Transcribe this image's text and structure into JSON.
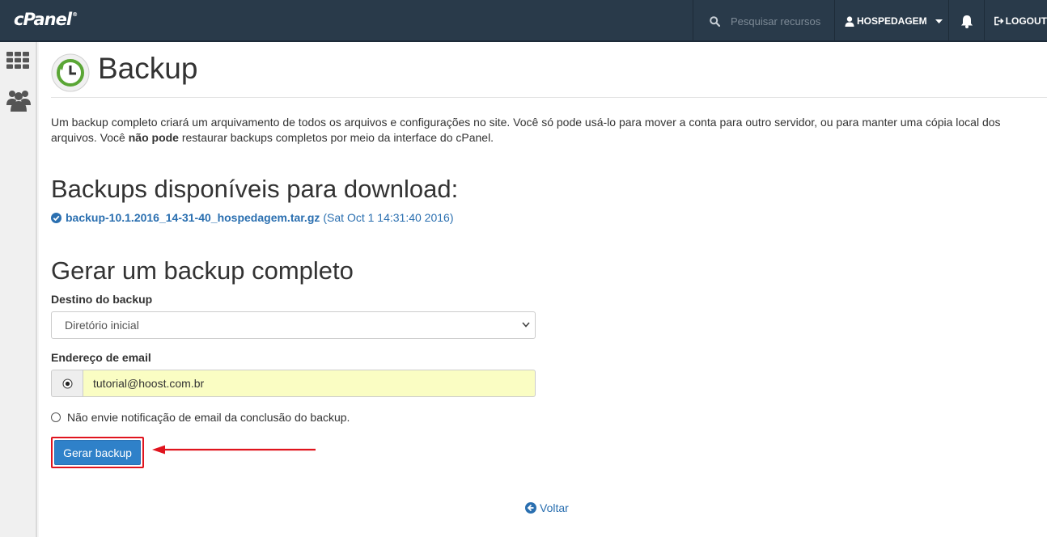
{
  "topbar": {
    "logo_text": "cPanel",
    "logo_mark": "®",
    "search_placeholder": "Pesquisar recursos",
    "user_label": "HOSPEDAGEM",
    "logout_label": "LOGOUT"
  },
  "sidebar": {
    "items": [
      {
        "icon": "grid-icon"
      },
      {
        "icon": "users-icon"
      }
    ]
  },
  "header": {
    "title": "Backup",
    "icon": "backup-clock-icon"
  },
  "intro": {
    "part1": "Um backup completo criará um arquivamento de todos os arquivos e configurações no site. Você só pode usá-lo para mover a conta para outro servidor, ou para manter uma cópia local dos arquivos. Você ",
    "bold": "não pode",
    "part2": " restaurar backups completos por meio da interface do cPanel."
  },
  "available": {
    "heading": "Backups disponíveis para download:",
    "file_name": "backup-10.1.2016_14-31-40_hospedagem.tar.gz",
    "file_date": "(Sat Oct 1 14:31:40 2016)"
  },
  "generate": {
    "heading": "Gerar um backup completo",
    "destination_label": "Destino do backup",
    "destination_value": "Diretório inicial",
    "email_label": "Endereço de email",
    "email_value": "tutorial@hoost.com.br",
    "no_notify_label": "Não envie notificação de email da conclusão do backup.",
    "button_label": "Gerar backup"
  },
  "footer": {
    "back_label": "Voltar"
  },
  "colors": {
    "topbar": "#293a4a",
    "link": "#2a6fb0",
    "button": "#2f81c9",
    "highlight": "#e0141e",
    "email_bg": "#fafdc3"
  }
}
